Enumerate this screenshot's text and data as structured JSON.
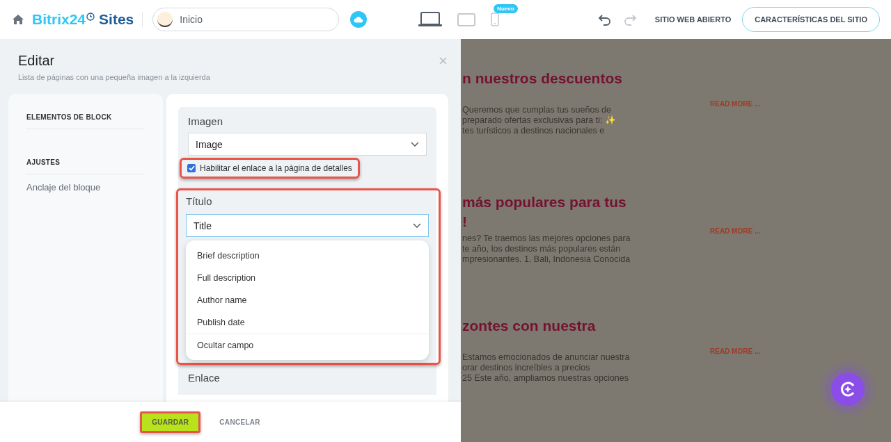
{
  "top_bar": {
    "logo": {
      "brand": "Bitrix24",
      "product": "Sites"
    },
    "page_selector": {
      "value": "Inicio"
    },
    "devices": [
      {
        "kind": "laptop",
        "selected": true
      },
      {
        "kind": "tablet",
        "selected": false
      },
      {
        "kind": "phone",
        "selected": false,
        "badge": "Nuevo"
      }
    ],
    "history": [
      {
        "kind": "undo",
        "disabled": false
      },
      {
        "kind": "redo",
        "disabled": true
      }
    ],
    "open_site_link": "SITIO WEB ABIERTO",
    "site_settings_button": "CARACTERÍSTICAS DEL SITIO"
  },
  "editor": {
    "title": "Editar",
    "subtitle": "Lista de páginas con una pequeña imagen a la izquierda",
    "sidebar": [
      {
        "heading": "ELEMENTOS DE BLOCK"
      },
      {
        "heading": "AJUSTES",
        "items": [
          "Anclaje del bloque"
        ]
      }
    ],
    "fields": [
      {
        "label": "Imagen",
        "value": "Image",
        "checkbox": {
          "label": "Habilitar el enlace a la página de detalles",
          "checked": true,
          "highlighted": true
        }
      },
      {
        "label": "Título",
        "value": "Title",
        "highlighted": true,
        "focused": true,
        "options": [
          {
            "label": "Brief description",
            "kind": "option"
          },
          {
            "label": "Full description",
            "kind": "option"
          },
          {
            "label": "Author name",
            "kind": "option"
          },
          {
            "label": "Publish date",
            "kind": "option"
          },
          {
            "label": "Ocultar campo",
            "kind": "hide"
          }
        ]
      },
      {
        "label": "Enlace"
      }
    ],
    "footer": [
      {
        "label": "GUARDAR",
        "kind": "primary",
        "highlighted": true
      },
      {
        "label": "CANCELAR",
        "kind": "link",
        "highlighted": false
      }
    ]
  },
  "preview": {
    "articles": [
      {
        "title_lines": [
          "n nuestros descuentos"
        ],
        "body_lines": [
          "Queremos que cumplas tus sueños de",
          "preparado ofertas exclusivas para ti: ✨",
          "tes turísticos a destinos nacionales e"
        ],
        "link": "READ MORE ..."
      },
      {
        "title_lines": [
          "más populares para tus",
          "!"
        ],
        "body_lines": [
          "nes? Te traemos las mejores opciones para",
          "te año, los destinos más populares están",
          "mpresionantes. 1. Bali, Indonesia Conocida"
        ],
        "link": "READ MORE ..."
      },
      {
        "title_lines": [
          "zontes con nuestra"
        ],
        "body_lines": [
          "Estamos emocionados de anunciar nuestra",
          "orar destinos increíbles a precios",
          "25 Este año, ampliamos nuestras opciones"
        ],
        "link": "READ MORE ..."
      }
    ]
  }
}
